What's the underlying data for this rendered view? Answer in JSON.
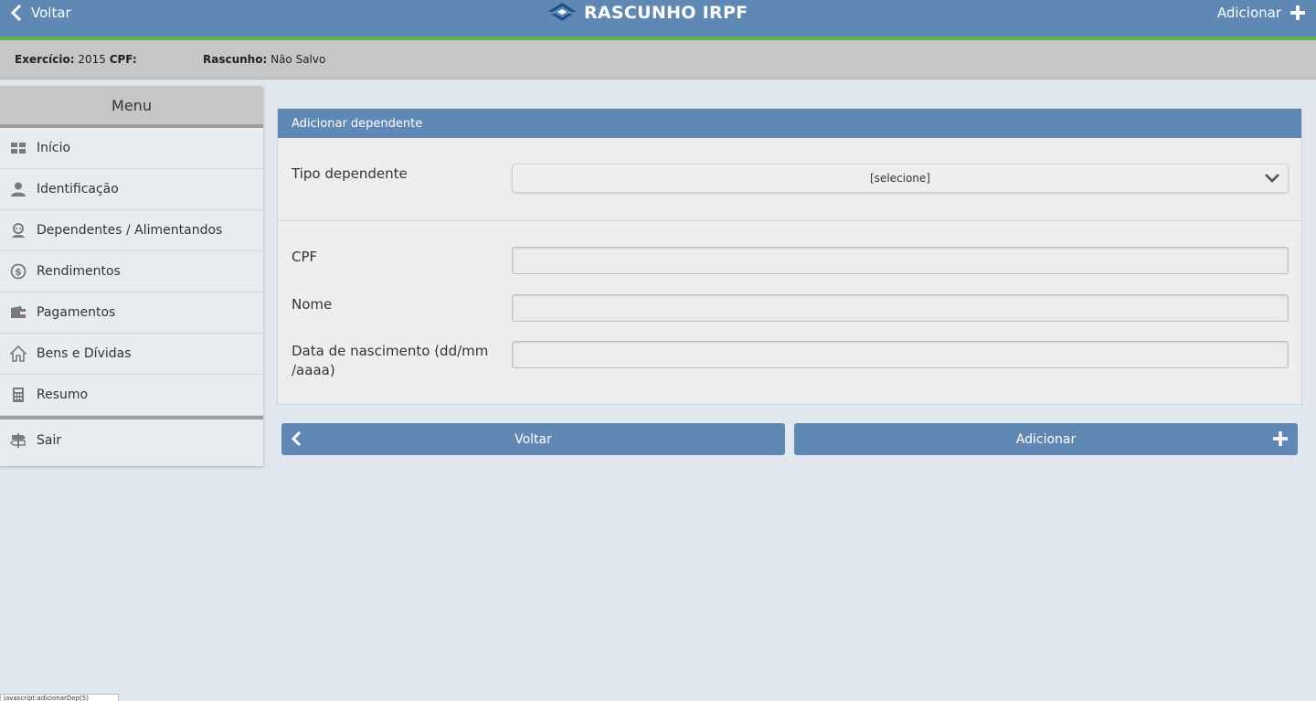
{
  "header": {
    "back_label": "Voltar",
    "title": "RASCUNHO IRPF",
    "add_label": "Adicionar",
    "colors": {
      "bar": "#5f88b4",
      "accent": "#5fb04a"
    }
  },
  "infobar": {
    "exercicio_label": "Exercício:",
    "exercicio_value": "2015",
    "cpf_label": "CPF:",
    "cpf_value": "",
    "rascunho_label": "Rascunho:",
    "rascunho_value": "Não Salvo"
  },
  "sidebar": {
    "title": "Menu",
    "items": [
      {
        "label": "Início",
        "icon": "grid-icon"
      },
      {
        "label": "Identificação",
        "icon": "person-icon"
      },
      {
        "label": "Dependentes / Alimentandos",
        "icon": "people-icon"
      },
      {
        "label": "Rendimentos",
        "icon": "dollar-icon"
      },
      {
        "label": "Pagamentos",
        "icon": "wallet-icon"
      },
      {
        "label": "Bens e Dívidas",
        "icon": "home-icon"
      },
      {
        "label": "Resumo",
        "icon": "calculator-icon"
      }
    ],
    "exit": {
      "label": "Sair",
      "icon": "signpost-icon"
    }
  },
  "form": {
    "title": "Adicionar dependente",
    "tipo_label": "Tipo dependente",
    "tipo_value": "[selecione]",
    "cpf_label": "CPF",
    "cpf_value": "",
    "nome_label": "Nome",
    "nome_value": "",
    "nascimento_label": "Data de nascimento (dd/mm /aaaa)",
    "nascimento_value": ""
  },
  "buttons": {
    "back_label": "Voltar",
    "add_label": "Adicionar"
  },
  "status_tip": "javascript:adicionarDep(5)"
}
